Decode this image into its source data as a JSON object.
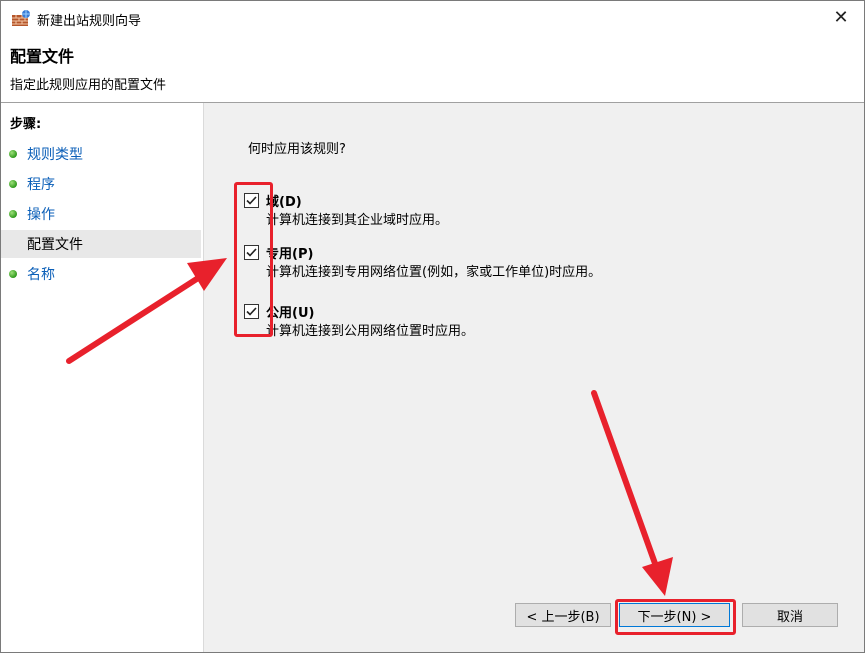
{
  "window": {
    "title": "新建出站规则向导",
    "close_glyph": "✕"
  },
  "header": {
    "title": "配置文件",
    "subtitle": "指定此规则应用的配置文件"
  },
  "sidebar": {
    "heading": "步骤:",
    "items": [
      {
        "label": "规则类型",
        "active": false
      },
      {
        "label": "程序",
        "active": false
      },
      {
        "label": "操作",
        "active": false
      },
      {
        "label": "配置文件",
        "active": true
      },
      {
        "label": "名称",
        "active": false
      }
    ]
  },
  "main": {
    "question": "何时应用该规则?",
    "options": [
      {
        "title": "域(D)",
        "description": "计算机连接到其企业域时应用。",
        "checked": true
      },
      {
        "title": "专用(P)",
        "description": "计算机连接到专用网络位置(例如，家或工作单位)时应用。",
        "checked": true
      },
      {
        "title": "公用(U)",
        "description": "计算机连接到公用网络位置时应用。",
        "checked": true
      }
    ]
  },
  "buttons": {
    "back": "< 上一步(B)",
    "next": "下一步(N) >",
    "cancel": "取消"
  },
  "colors": {
    "annotation": "#e8212c",
    "link": "#0b5fb8",
    "content_bg": "#f0f0f0"
  }
}
